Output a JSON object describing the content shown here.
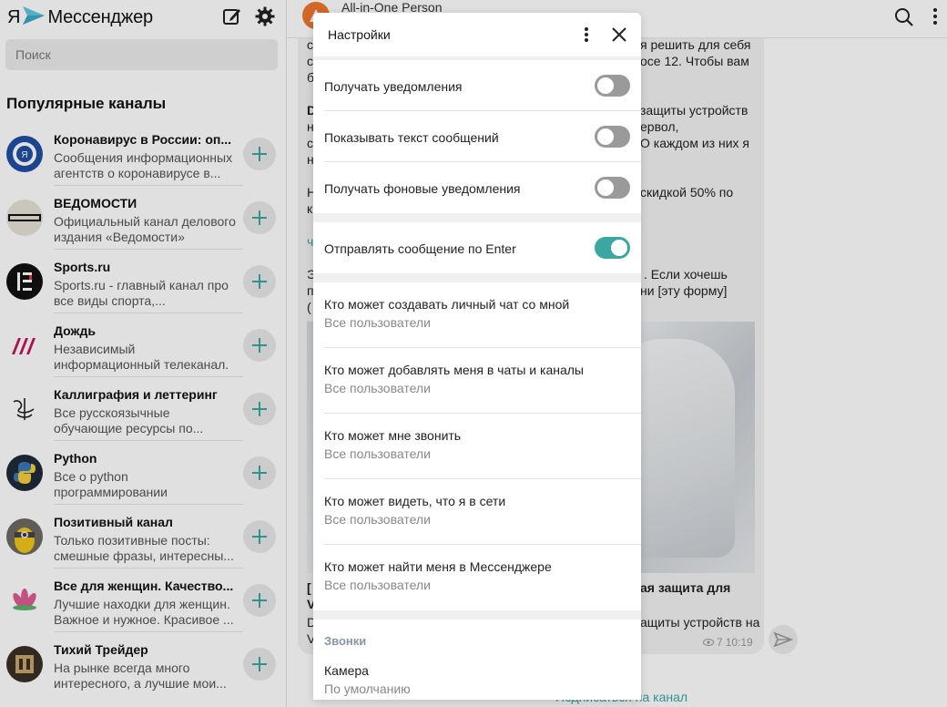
{
  "app": {
    "logo_ya": "Я",
    "title": "Мессенджер",
    "search_placeholder": "Поиск"
  },
  "sidebar": {
    "section_title": "Популярные каналы",
    "channels": [
      {
        "name": "Коронавирус в России: оп...",
        "desc": "Сообщения информационных агентств о коронавирусе в..."
      },
      {
        "name": "ВЕДОМОСТИ",
        "desc": "Официальный канал делового издания «Ведомости»"
      },
      {
        "name": "Sports.ru",
        "desc": "Sports.ru - главный канал про все виды спорта,..."
      },
      {
        "name": "Дождь",
        "desc": "Независимый информационный телеканал."
      },
      {
        "name": "Каллиграфия и леттеринг",
        "desc": "Все русскоязычные обучающие ресурсы по..."
      },
      {
        "name": "Python",
        "desc": "Все о python программировании"
      },
      {
        "name": "Позитивный канал",
        "desc": "Только позитивные посты: смешные фразы, интересны..."
      },
      {
        "name": "Все для женщин. Качество...",
        "desc": "Лучшие находки для женщин. Важное и нужное. Красивое ..."
      },
      {
        "name": "Тихий Трейдер",
        "desc": "На рынке всегда много интересного, а лучшие мои..."
      }
    ],
    "colors": {
      "accent": "#3aa7a1"
    }
  },
  "main": {
    "chat_title": "All-in-One Person",
    "fragments": {
      "f1": "с",
      "f1r": "я решить для себя",
      "f2": "с",
      "f2r": "осе 12. Чтобы вам",
      "f3": "б",
      "f4": "D",
      "f4r": "защиты устройств",
      "f5": "н",
      "f5r": "ервол,",
      "f6": "с",
      "f6r": "О каждом из них я",
      "f7": "н",
      "f8": "Н",
      "f8r": "скидкой 50% по",
      "f9": "к",
      "f10": "ч",
      "f11": "Э",
      "f11r": ". Если хочешь",
      "f12": "п",
      "f12r": "ни [эту форму]",
      "f13": "(",
      "f14": "[",
      "f14r": "ая защита для",
      "f15": "V",
      "f16": "D",
      "f16r": "ащиты устройств на",
      "f17": "V"
    },
    "views": "7",
    "time": "10:19",
    "subscribe_label": "Подписаться на канал"
  },
  "settings": {
    "title": "Настройки",
    "toggles": [
      {
        "label": "Получать уведомления",
        "on": false
      },
      {
        "label": "Показывать текст сообщений",
        "on": false
      },
      {
        "label": "Получать фоновые уведомления",
        "on": false
      }
    ],
    "enter_toggle": {
      "label": "Отправлять сообщение по Enter",
      "on": true
    },
    "privacy": [
      {
        "label": "Кто может создавать личный чат со мной",
        "value": "Все пользователи"
      },
      {
        "label": "Кто может добавлять меня в чаты и каналы",
        "value": "Все пользователи"
      },
      {
        "label": "Кто может мне звонить",
        "value": "Все пользователи"
      },
      {
        "label": "Кто может видеть, что я в сети",
        "value": "Все пользователи"
      },
      {
        "label": "Кто может найти меня в Мессенджере",
        "value": "Все пользователи"
      }
    ],
    "calls_section": "Звонки",
    "camera": {
      "label": "Камера",
      "value": "По умолчанию"
    }
  }
}
